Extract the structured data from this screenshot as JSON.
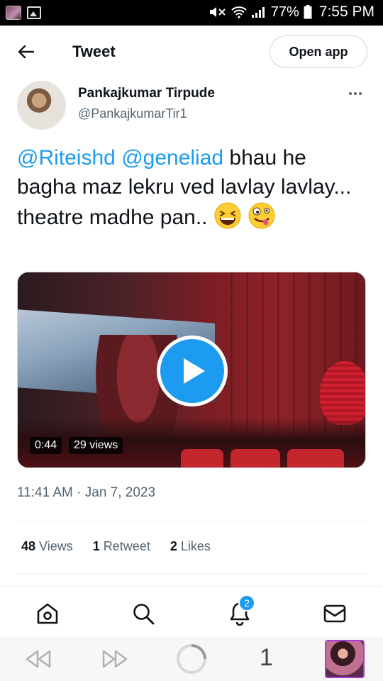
{
  "status_bar": {
    "battery": "77%",
    "time": "7:55 PM"
  },
  "header": {
    "title": "Tweet",
    "open_app_label": "Open app"
  },
  "author": {
    "name": "Pankajkumar Tirpude",
    "handle": "@PankajkumarTir1"
  },
  "tweet": {
    "mention1": "@Riteishd",
    "mention2": "@geneliad",
    "text": " bhau he bagha maz lekru ved lavlay lavlay... theatre madhe pan.. ",
    "emojis": [
      "grinning-squinting-face",
      "zany-face"
    ]
  },
  "media": {
    "duration": "0:44",
    "views": "29 views"
  },
  "timestamp": "11:41 AM · Jan 7, 2023",
  "stats": {
    "views_count": "48",
    "views_label": "Views",
    "retweets_count": "1",
    "retweets_label": "Retweet",
    "likes_count": "2",
    "likes_label": "Likes"
  },
  "bottom_nav": {
    "notification_badge": "2"
  },
  "browser_bar": {
    "tab_count": "1"
  },
  "colors": {
    "accent": "#1d9bf0",
    "text": "#0f1419",
    "secondary": "#536471"
  }
}
